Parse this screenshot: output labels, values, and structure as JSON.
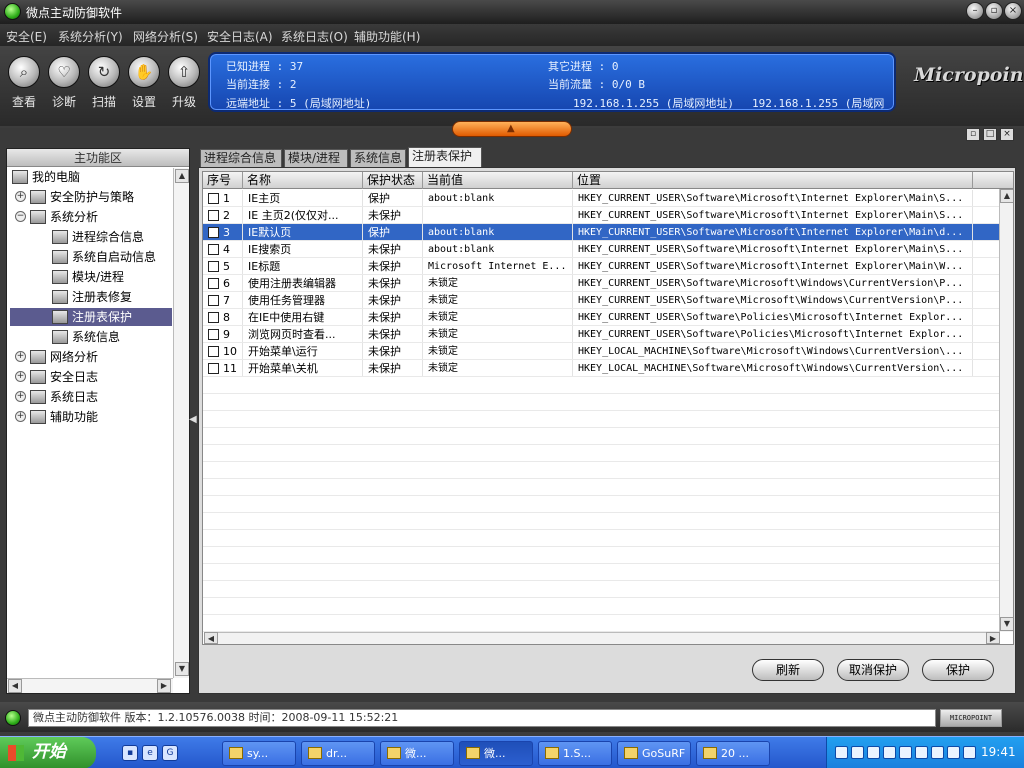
{
  "window": {
    "title": "微点主动防御软件"
  },
  "menu": [
    "安全(E)",
    "系统分析(Y)",
    "网络分析(S)",
    "安全日志(A)",
    "系统日志(O)",
    "辅助功能(H)"
  ],
  "tools": [
    {
      "label": "查看",
      "icon": "magnifier-icon"
    },
    {
      "label": "诊断",
      "icon": "heart-icon"
    },
    {
      "label": "扫描",
      "icon": "scan-icon"
    },
    {
      "label": "设置",
      "icon": "hand-icon"
    },
    {
      "label": "升级",
      "icon": "upgrade-icon"
    }
  ],
  "info": {
    "known_proc": "已知进程 : 37",
    "other_proc": "其它进程 : 0",
    "current_conn": "当前连接 : 2",
    "current_flow": "当前流量 : 0/0 B",
    "remote_addr": "远端地址 :  5 (局域网地址)",
    "ip1": "192.168.1.255 (局域网地址)",
    "ip2": "192.168.1.255 (局域网"
  },
  "logo_text": "Micropoint",
  "left_panel": {
    "header": "主功能区",
    "tree": [
      {
        "label": "我的电脑"
      },
      {
        "label": "安全防护与策略"
      },
      {
        "label": "系统分析"
      },
      {
        "label": "进程综合信息"
      },
      {
        "label": "系统自启动信息"
      },
      {
        "label": "模块/进程"
      },
      {
        "label": "注册表修复"
      },
      {
        "label": "注册表保护"
      },
      {
        "label": "系统信息"
      },
      {
        "label": "网络分析"
      },
      {
        "label": "安全日志"
      },
      {
        "label": "系统日志"
      },
      {
        "label": "辅助功能"
      }
    ]
  },
  "tabs": [
    "进程综合信息",
    "模块/进程",
    "系统信息",
    "注册表保护"
  ],
  "table": {
    "columns": [
      "序号",
      "名称",
      "保护状态",
      "当前值",
      "位置"
    ],
    "rows": [
      [
        "1",
        "IE主页",
        "保护",
        "about:blank",
        "HKEY_CURRENT_USER\\Software\\Microsoft\\Internet Explorer\\Main\\S..."
      ],
      [
        "2",
        "IE 主页2(仅仅对...",
        "未保护",
        "",
        "HKEY_CURRENT_USER\\Software\\Microsoft\\Internet Explorer\\Main\\S..."
      ],
      [
        "3",
        "IE默认页",
        "保护",
        "about:blank",
        "HKEY_CURRENT_USER\\Software\\Microsoft\\Internet Explorer\\Main\\d..."
      ],
      [
        "4",
        "IE搜索页",
        "未保护",
        "about:blank",
        "HKEY_CURRENT_USER\\Software\\Microsoft\\Internet Explorer\\Main\\S..."
      ],
      [
        "5",
        "IE标题",
        "未保护",
        "Microsoft Internet E...",
        "HKEY_CURRENT_USER\\Software\\Microsoft\\Internet Explorer\\Main\\W..."
      ],
      [
        "6",
        "使用注册表编辑器",
        "未保护",
        "未锁定",
        "HKEY_CURRENT_USER\\Software\\Microsoft\\Windows\\CurrentVersion\\P..."
      ],
      [
        "7",
        "使用任务管理器",
        "未保护",
        "未锁定",
        "HKEY_CURRENT_USER\\Software\\Microsoft\\Windows\\CurrentVersion\\P..."
      ],
      [
        "8",
        "在IE中使用右键",
        "未保护",
        "未锁定",
        "HKEY_CURRENT_USER\\Software\\Policies\\Microsoft\\Internet Explor..."
      ],
      [
        "9",
        "浏览网页时查看...",
        "未保护",
        "未锁定",
        "HKEY_CURRENT_USER\\Software\\Policies\\Microsoft\\Internet Explor..."
      ],
      [
        "10",
        "开始菜单\\运行",
        "未保护",
        "未锁定",
        "HKEY_LOCAL_MACHINE\\Software\\Microsoft\\Windows\\CurrentVersion\\..."
      ],
      [
        "11",
        "开始菜单\\关机",
        "未保护",
        "未锁定",
        "HKEY_LOCAL_MACHINE\\Software\\Microsoft\\Windows\\CurrentVersion\\..."
      ]
    ],
    "selected_row": 3
  },
  "buttons": {
    "refresh": "刷新",
    "unprotect": "取消保护",
    "protect": "保护"
  },
  "status": {
    "text": "微点主动防御软件    版本：1.2.10576.0038    时间：2008-09-11 15:52:21",
    "badge": "MICROPOINT"
  },
  "taskbar": {
    "start": "开始",
    "tasks": [
      "sy...",
      "dr...",
      "微...",
      "微...",
      "1.S...",
      "GoSuRF",
      "20 ..."
    ],
    "clock": "19:41"
  }
}
